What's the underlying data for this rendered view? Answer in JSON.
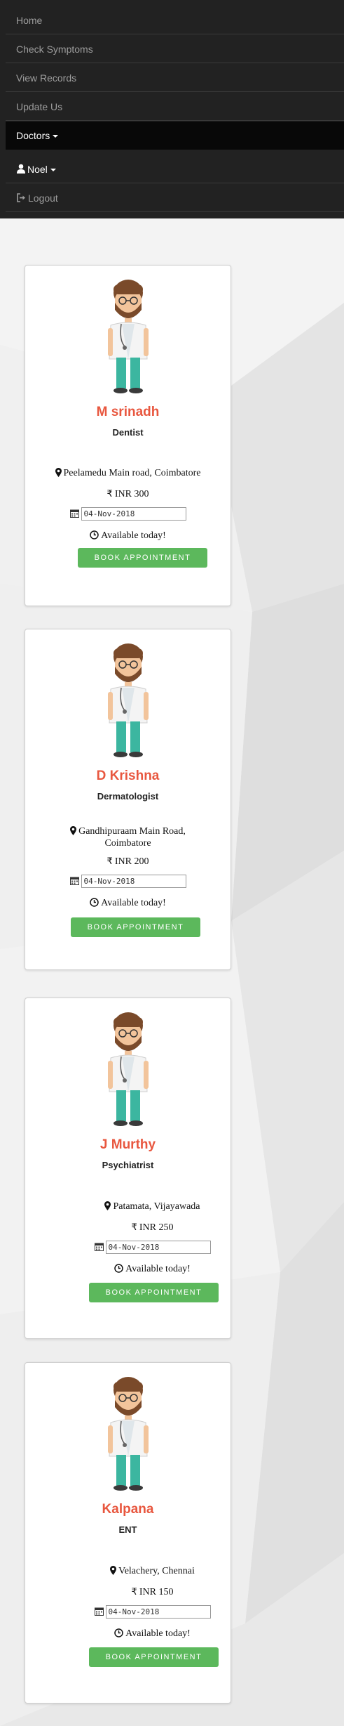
{
  "nav": {
    "items": [
      {
        "label": "Home"
      },
      {
        "label": "Check Symptoms"
      },
      {
        "label": "View Records"
      },
      {
        "label": "Update Us"
      }
    ],
    "doctors_label": "Doctors",
    "user_label": "Noel",
    "logout_label": "Logout"
  },
  "doctors": [
    {
      "name": "M srinadh",
      "specialty": "Dentist",
      "location": "Peelamedu Main road, Coimbatore",
      "location2": "",
      "fee": "INR 300",
      "date": "04-Nov-2018",
      "availability": "Available today!",
      "button": "BOOK APPOINTMENT"
    },
    {
      "name": "D Krishna",
      "specialty": "Dermatologist",
      "location": "Gandhipuraam Main Road,",
      "location2": "Coimbatore",
      "fee": "INR 200",
      "date": "04-Nov-2018",
      "availability": "Available today!",
      "button": "BOOK APPOINTMENT"
    },
    {
      "name": "J Murthy",
      "specialty": "Psychiatrist",
      "location": "Patamata, Vijayawada",
      "location2": "",
      "fee": "INR 250",
      "date": "04-Nov-2018",
      "availability": "Available today!",
      "button": "BOOK APPOINTMENT"
    },
    {
      "name": "Kalpana",
      "specialty": "ENT",
      "location": "Velachery, Chennai",
      "location2": "",
      "fee": "INR 150",
      "date": "04-Nov-2018",
      "availability": "Available today!",
      "button": "BOOK APPOINTMENT"
    }
  ],
  "icons": {
    "location": "map-marker-icon",
    "fee": "rupee-icon",
    "date": "calendar-icon",
    "availability": "clock-icon",
    "user": "user-icon",
    "logout": "logout-icon"
  },
  "colors": {
    "navbar": "#222222",
    "doctor_name": "#e8573f",
    "button": "#5cb85c"
  }
}
